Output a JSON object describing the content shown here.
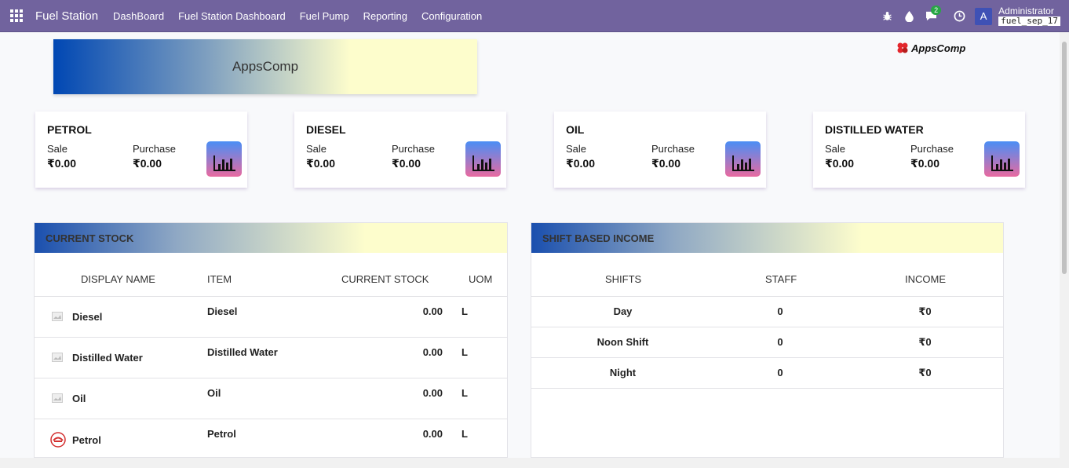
{
  "navbar": {
    "app_name": "Fuel Station",
    "menu": [
      "DashBoard",
      "Fuel Station Dashboard",
      "Fuel Pump",
      "Reporting",
      "Configuration"
    ],
    "message_count": "2",
    "avatar_letter": "A",
    "user": "Administrator",
    "database": "fuel_sep_17"
  },
  "banner": {
    "title": "AppsComp"
  },
  "logo": {
    "text": "AppsComp"
  },
  "cards": [
    {
      "title": "PETROL",
      "sale_label": "Sale",
      "sale_value": "₹0.00",
      "purchase_label": "Purchase",
      "purchase_value": "₹0.00"
    },
    {
      "title": "DIESEL",
      "sale_label": "Sale",
      "sale_value": "₹0.00",
      "purchase_label": "Purchase",
      "purchase_value": "₹0.00"
    },
    {
      "title": "OIL",
      "sale_label": "Sale",
      "sale_value": "₹0.00",
      "purchase_label": "Purchase",
      "purchase_value": "₹0.00"
    },
    {
      "title": "DISTILLED WATER",
      "sale_label": "Sale",
      "sale_value": "₹0.00",
      "purchase_label": "Purchase",
      "purchase_value": "₹0.00"
    }
  ],
  "current_stock": {
    "title": "CURRENT STOCK",
    "headers": [
      "DISPLAY NAME",
      "ITEM",
      "CURRENT STOCK",
      "UOM"
    ],
    "rows": [
      {
        "display_name": "Diesel",
        "item": "Diesel",
        "stock": "0.00",
        "uom": "L"
      },
      {
        "display_name": "Distilled Water",
        "item": "Distilled Water",
        "stock": "0.00",
        "uom": "L"
      },
      {
        "display_name": "Oil",
        "item": "Oil",
        "stock": "0.00",
        "uom": "L"
      },
      {
        "display_name": "Petrol",
        "item": "Petrol",
        "stock": "0.00",
        "uom": "L"
      }
    ]
  },
  "shift_income": {
    "title": "SHIFT BASED INCOME",
    "headers": [
      "SHIFTS",
      "STAFF",
      "INCOME"
    ],
    "rows": [
      {
        "shift": "Day",
        "staff": "0",
        "income": "₹0"
      },
      {
        "shift": "Noon Shift",
        "staff": "0",
        "income": "₹0"
      },
      {
        "shift": "Night",
        "staff": "0",
        "income": "₹0"
      }
    ]
  },
  "colors": {
    "navbar": "#71639e",
    "accent_blue": "#1a4fae",
    "accent_cream": "#fdfdcc",
    "icon_gradient_top": "#4a8ef5",
    "icon_gradient_bottom": "#e86aa0",
    "logo_red": "#e3262c"
  },
  "icons": {
    "apps": "apps-grid-icon",
    "debug": "bug-icon",
    "activity": "drop-icon",
    "messages": "chat-icon",
    "clock": "clock-icon",
    "card": "bar-chart-icon",
    "product_placeholder": "image-placeholder-icon",
    "petrol_product": "petrol-logo-icon"
  }
}
